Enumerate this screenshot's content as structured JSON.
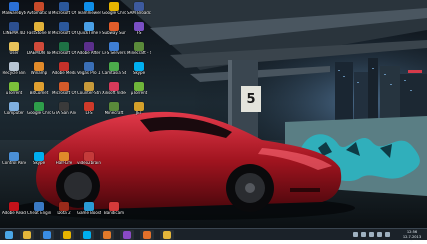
{
  "desktop": {
    "icons": [
      {
        "label": "Malwarebytes Anti-Malware",
        "icon": "malwarebytes-icon",
        "color": "#2a6fd6"
      },
      {
        "label": "Avtomatic Burning",
        "icon": "burn-disc-icon",
        "color": "#c74a2a"
      },
      {
        "label": "Microsoft Office Wo...",
        "icon": "word-icon",
        "color": "#2b579a"
      },
      {
        "label": "TeamViewer 8",
        "icon": "teamviewer-icon",
        "color": "#0e8ee9"
      },
      {
        "label": "Google Chrome",
        "icon": "chrome-icon",
        "color": "#e6b400"
      },
      {
        "label": "SAM Broadcaster",
        "icon": "radio-icon",
        "color": "#3d5a9e"
      },
      {
        "label": "CINEMA 4D",
        "icon": "cinema4d-icon",
        "color": "#2c4f8f"
      },
      {
        "label": "FastStone Image Viewer",
        "icon": "image-viewer-icon",
        "color": "#e2b23a"
      },
      {
        "label": "Microsoft Office Wo...",
        "icon": "word-icon",
        "color": "#2b579a"
      },
      {
        "label": "QuickTime Player",
        "icon": "quicktime-icon",
        "color": "#4aa0e6"
      },
      {
        "label": "Subway Surfers",
        "icon": "game-icon",
        "color": "#e25d2a"
      },
      {
        "label": "FS",
        "icon": "fs-icon",
        "color": "#7a4fc4"
      },
      {
        "label": "User",
        "icon": "folder-user-icon",
        "color": "#e8c35a"
      },
      {
        "label": "DAEMON Tools Pro",
        "icon": "daemon-tools-icon",
        "color": "#d04a3a"
      },
      {
        "label": "Microsoft Office Ex...",
        "icon": "excel-icon",
        "color": "#1e7145"
      },
      {
        "label": "Adobe After Effects CS4",
        "icon": "after-effects-icon",
        "color": "#5b2f8c"
      },
      {
        "label": "LFS Servers",
        "icon": "lfs-icon",
        "color": "#3e7ed4"
      },
      {
        "label": "Minecraft - Shortcut",
        "icon": "minecraft-icon",
        "color": "#5a8a3a"
      },
      {
        "label": "Recycle Bin",
        "icon": "recycle-bin-icon",
        "color": "#b8c6d4"
      },
      {
        "label": "Winamp",
        "icon": "winamp-icon",
        "color": "#e28b2a"
      },
      {
        "label": "Adobe Media Pl...",
        "icon": "adobe-media-icon",
        "color": "#c4312a"
      },
      {
        "label": "Vegas Pro 11.0",
        "icon": "vegas-icon",
        "color": "#3a6fb6"
      },
      {
        "label": "Camtasia Studio 8",
        "icon": "camtasia-icon",
        "color": "#4bab4b"
      },
      {
        "label": "Skype",
        "icon": "skype-icon",
        "color": "#00aff0"
      },
      {
        "label": "uTorrent",
        "icon": "utorrent-icon",
        "color": "#7bbf3a"
      },
      {
        "label": "BitComet",
        "icon": "bitcomet-icon",
        "color": "#e0a030"
      },
      {
        "label": "Microsoft Office...",
        "icon": "office-icon",
        "color": "#d35a2a"
      },
      {
        "label": "Counter-Strike",
        "icon": "counter-strike-icon",
        "color": "#c89a3a"
      },
      {
        "label": "Xilisoft Video...",
        "icon": "video-converter-icon",
        "color": "#d63a5a"
      },
      {
        "label": "µTorrent",
        "icon": "torrent-icon",
        "color": "#6fb53a"
      },
      {
        "label": "Computer",
        "icon": "computer-icon",
        "color": "#7fb0e0"
      },
      {
        "label": "Google Chrome",
        "icon": "chrome-icon",
        "color": "#2e9e4a"
      },
      {
        "label": "GTA San Andreas",
        "icon": "gta-icon",
        "color": "#3a3a3a"
      },
      {
        "label": "LFS",
        "icon": "car-game-icon",
        "color": "#cf3a2a"
      },
      {
        "label": "Minecraft",
        "icon": "minecraft-icon",
        "color": "#5a8a3a"
      },
      {
        "label": "JET",
        "icon": "jet-icon",
        "color": "#d4a02a"
      },
      {
        "label": "Control Panel",
        "icon": "control-panel-icon",
        "color": "#4a8fd6"
      },
      {
        "label": "Skype",
        "icon": "skype-icon",
        "color": "#00aff0"
      },
      {
        "label": "Half-Life",
        "icon": "half-life-icon",
        "color": "#e08a2a"
      },
      {
        "label": "video2brain",
        "icon": "video-icon",
        "color": "#c43a3a"
      },
      {
        "label": "Adobe Reader XI",
        "icon": "adobe-reader-icon",
        "color": "#c4121a"
      },
      {
        "label": "Cheat Engine",
        "icon": "cheat-engine-icon",
        "color": "#3a7ac4"
      },
      {
        "label": "Dota 2",
        "icon": "dota-icon",
        "color": "#9a2a1a"
      },
      {
        "label": "Game Booster",
        "icon": "game-booster-icon",
        "color": "#2a9ad4"
      },
      {
        "label": "Bandicam",
        "icon": "bandicam-icon",
        "color": "#d43a3a"
      }
    ]
  },
  "taskbar": {
    "buttons": [
      {
        "name": "file-explorer-icon",
        "color": "#e3b63a"
      },
      {
        "name": "internet-explorer-icon",
        "color": "#3a8ee6"
      },
      {
        "name": "chrome-icon",
        "color": "#e6b400"
      },
      {
        "name": "skype-icon",
        "color": "#00aff0"
      },
      {
        "name": "media-player-icon",
        "color": "#e27a2a"
      },
      {
        "name": "winrar-icon",
        "color": "#8a4ac4"
      },
      {
        "name": "firefox-icon",
        "color": "#e2702a"
      },
      {
        "name": "folder-icon",
        "color": "#e3b63a"
      }
    ],
    "clock": {
      "time": "12:56",
      "date": "12.7.2013 г."
    }
  }
}
